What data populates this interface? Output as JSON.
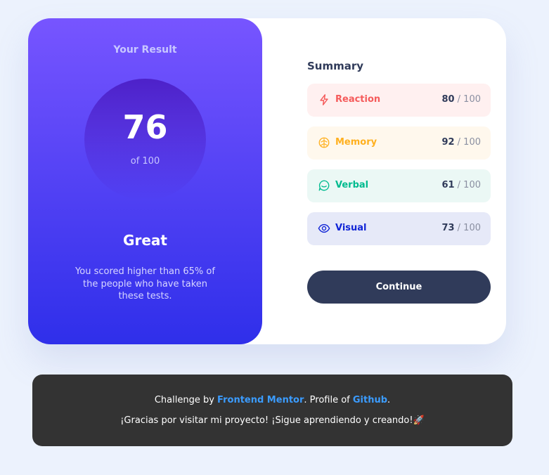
{
  "result": {
    "title": "Your Result",
    "score": "76",
    "of_label": "of 100",
    "rating": "Great",
    "description": "You scored higher than 65% of the people who have taken these tests."
  },
  "summary": {
    "title": "Summary",
    "items": [
      {
        "label": "Reaction",
        "score": "80",
        "max": " / 100",
        "icon": "lightning-icon",
        "color": "#f55b5b",
        "bg": "#fff0f0"
      },
      {
        "label": "Memory",
        "score": "92",
        "max": " / 100",
        "icon": "brain-icon",
        "color": "#ffb01f",
        "bg": "#fff8ed"
      },
      {
        "label": "Verbal",
        "score": "61",
        "max": " / 100",
        "icon": "speech-bubble-icon",
        "color": "#00bb8f",
        "bg": "#ebf8f5"
      },
      {
        "label": "Visual",
        "score": "73",
        "max": " / 100",
        "icon": "eye-icon",
        "color": "#1125d6",
        "bg": "#e6e9f8"
      }
    ]
  },
  "continue_label": "Continue",
  "footer": {
    "prefix": "Challenge by ",
    "link1": "Frontend Mentor",
    "middle": ". Profile of ",
    "link2": "Github",
    "suffix": ".",
    "line2": "¡Gracias por visitar mi proyecto! ¡Sigue aprendiendo y creando!",
    "emoji": "🚀"
  },
  "colors": {
    "accent_gradient_start": "#7755ff",
    "accent_gradient_end": "#2f2fea",
    "button": "#303b5a",
    "link": "#3b9cff"
  }
}
